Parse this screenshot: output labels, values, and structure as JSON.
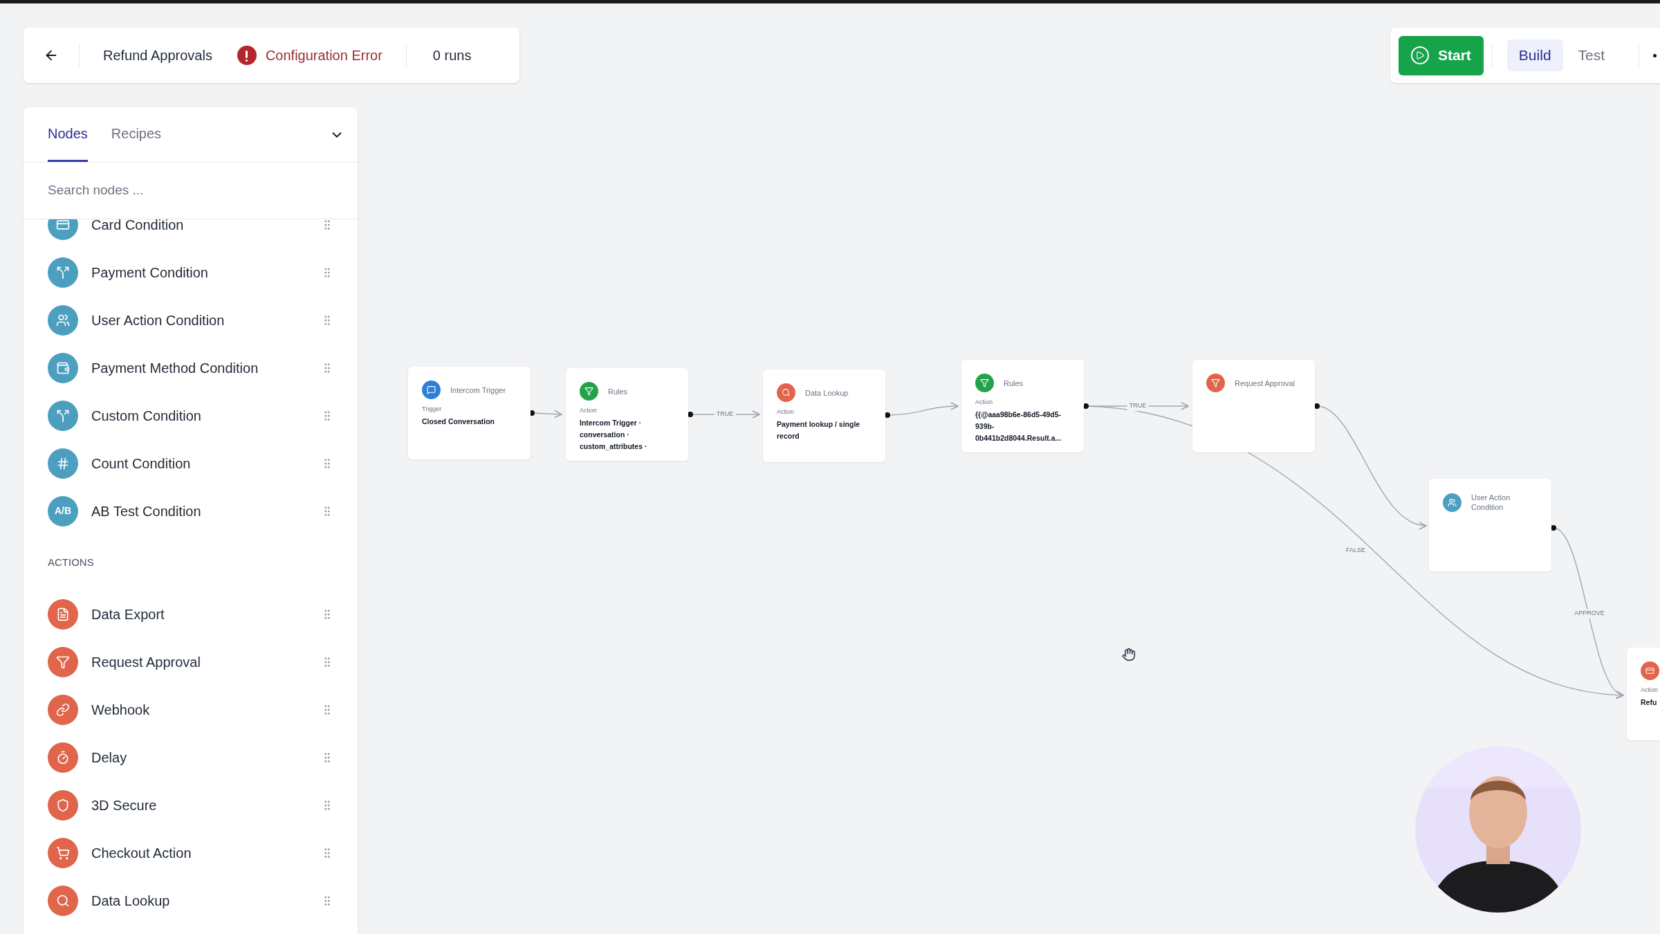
{
  "header": {
    "title": "Refund Approvals",
    "status": "Configuration Error",
    "runs": "0 runs"
  },
  "toolbar": {
    "start": "Start",
    "modes": [
      {
        "label": "Build",
        "selected": true
      },
      {
        "label": "Test",
        "selected": false
      }
    ]
  },
  "sidebar": {
    "tabs": [
      {
        "label": "Nodes",
        "selected": true
      },
      {
        "label": "Recipes",
        "selected": false
      }
    ],
    "search": {
      "placeholder": "Search nodes ..."
    },
    "sections": [
      {
        "items": [
          {
            "label": "Card Condition",
            "color": "#4d9fc0"
          },
          {
            "label": "Payment Condition",
            "color": "#4d9fc0"
          },
          {
            "label": "User Action Condition",
            "color": "#4d9fc0"
          },
          {
            "label": "Payment Method Condition",
            "color": "#4d9fc0"
          },
          {
            "label": "Custom Condition",
            "color": "#4d9fc0"
          },
          {
            "label": "Count Condition",
            "color": "#4d9fc0"
          },
          {
            "label": "AB Test Condition",
            "color": "#4d9fc0",
            "icon_text": "A/B"
          }
        ]
      },
      {
        "title": "ACTIONS",
        "items": [
          {
            "label": "Data Export",
            "color": "#e0654a"
          },
          {
            "label": "Request Approval",
            "color": "#e0654a"
          },
          {
            "label": "Webhook",
            "color": "#e0654a"
          },
          {
            "label": "Delay",
            "color": "#e0654a"
          },
          {
            "label": "3D Secure",
            "color": "#e0654a"
          },
          {
            "label": "Checkout Action",
            "color": "#e0654a"
          },
          {
            "label": "Data Lookup",
            "color": "#e0654a"
          }
        ]
      }
    ]
  },
  "canvas": {
    "nodes": [
      {
        "kind": "trigger",
        "title": "Intercom Trigger",
        "color": "#2f7fd8",
        "sublabel": "Trigger",
        "text": "Closed Conversation"
      },
      {
        "kind": "rules",
        "title": "Rules",
        "color": "#22a34a",
        "sublabel": "Action",
        "text": "Intercom Trigger · conversation · custom_attributes ·"
      },
      {
        "kind": "lookup",
        "title": "Data Lookup",
        "color": "#e0654a",
        "sublabel": "Action",
        "text": "Payment lookup / single record"
      },
      {
        "kind": "rules",
        "title": "Rules",
        "color": "#22a34a",
        "sublabel": "Action",
        "text": "{{@aaa98b6e-86d5-49d5-939b-0b441b2d8044.Result.a..."
      },
      {
        "kind": "approval",
        "title": "Request Approval",
        "color": "#e0654a"
      },
      {
        "kind": "user",
        "title": "User Action Condition",
        "color": "#4d9fc0"
      },
      {
        "kind": "card",
        "color": "#e0654a",
        "sublabel": "Action",
        "text": "Refu"
      }
    ],
    "edge_labels": [
      "TRUE",
      "TRUE",
      "FALSE",
      "APPROVE"
    ]
  }
}
